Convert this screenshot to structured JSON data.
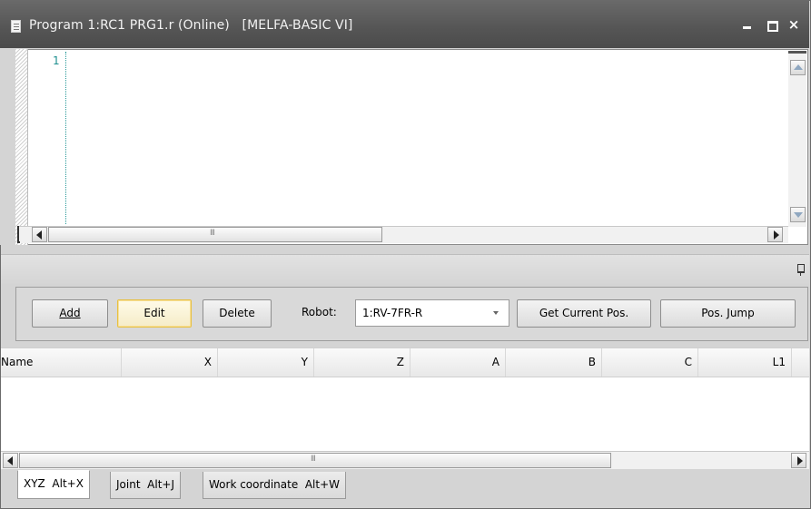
{
  "window": {
    "title": "Program 1:RC1 PRG1.r (Online)   [MELFA-BASIC VI]",
    "icon": "document-icon",
    "controls": {
      "minimize": "minimize-icon",
      "maximize": "maximize-icon",
      "close": "×"
    }
  },
  "editor": {
    "line_numbers": [
      "1"
    ],
    "hscroll_grip": "III"
  },
  "toolbar": {
    "add_label": "Add",
    "edit_label": "Edit",
    "delete_label": "Delete",
    "robot_label": "Robot:",
    "robot_value": "1:RV-7FR-R",
    "get_current_pos_label": "Get Current Pos.",
    "pos_jump_label": "Pos. Jump"
  },
  "table": {
    "columns": [
      "Name",
      "X",
      "Y",
      "Z",
      "A",
      "B",
      "C",
      "L1"
    ],
    "rows": [],
    "hscroll_grip": "III"
  },
  "tabs": [
    {
      "label": "XYZ  Alt+X",
      "active": true
    },
    {
      "label": "Joint  Alt+J",
      "active": false
    },
    {
      "label": "Work coordinate  Alt+W",
      "active": false
    }
  ],
  "colors": {
    "titlebar": "#555555",
    "line_number": "#1e8f8f",
    "focus_border": "#e8c040"
  }
}
